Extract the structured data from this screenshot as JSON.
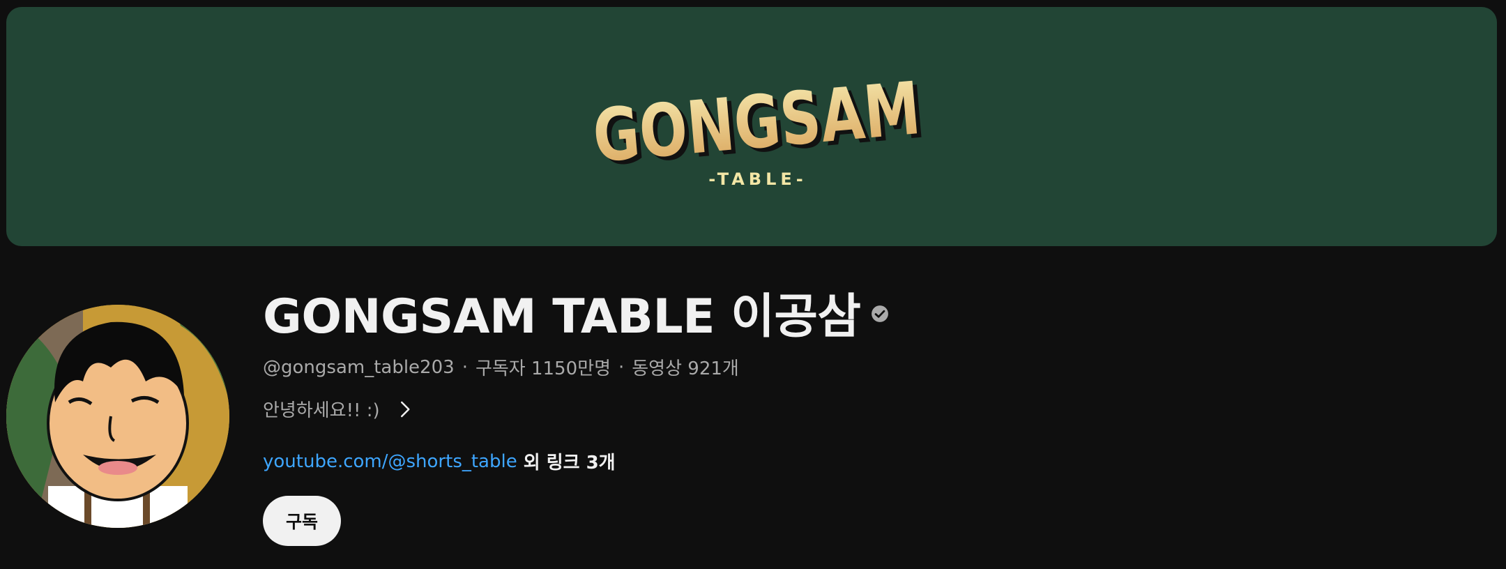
{
  "banner": {
    "logo_main": "GONGSAM",
    "logo_sub": "-TABLE-"
  },
  "channel": {
    "name": "GONGSAM TABLE 이공삼",
    "handle": "@gongsam_table203",
    "separator": "·",
    "subscribers": "구독자 1150만명",
    "videos": "동영상 921개",
    "description": "안녕하세요!! :)",
    "primary_link": "youtube.com/@shorts_table",
    "more_links": "외 링크 3개",
    "subscribe_label": "구독"
  },
  "icons": {
    "verified": "verified-check-icon",
    "more": "chevron-right-icon"
  },
  "colors": {
    "background": "#0f0f0f",
    "banner": "#224535",
    "link": "#3ea6ff",
    "logo_light": "#f3e6a6",
    "logo_dark": "#d9a45a"
  }
}
